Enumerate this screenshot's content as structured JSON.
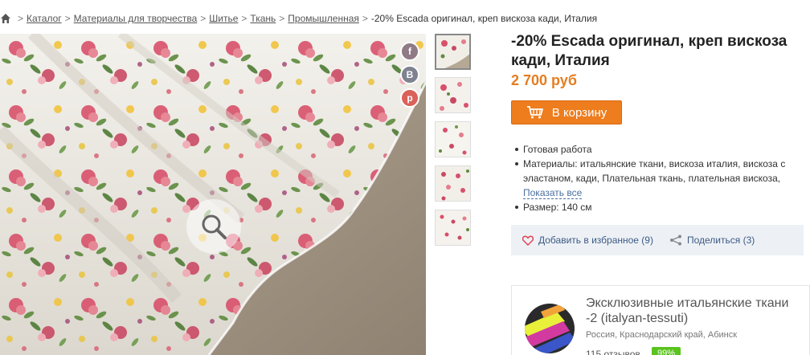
{
  "breadcrumb": {
    "items": [
      "Каталог",
      "Материалы для творчества",
      "Шитье",
      "Ткань",
      "Промышленная"
    ],
    "separator": ">",
    "current": "-20% Escada оригинал, креп вискоза кади, Италия"
  },
  "product": {
    "title": "-20% Escada оригинал, креп вискоза кади, Италия",
    "price": "2 700 руб",
    "cart_label": "В корзину"
  },
  "share": {
    "facebook": "f",
    "vk": "B",
    "pinterest": "p"
  },
  "attributes": {
    "ready": "Готовая работа",
    "materials": "Материалы: итальянские ткани, вискоза италия, вискоза с эластаном, кади, Плательная ткань, плательная вискоза,",
    "show_all": "Показать все",
    "size": "Размер: 140 см"
  },
  "actions": {
    "favorite": "Добавить в избранное (9)",
    "share": "Поделиться (3)"
  },
  "seller": {
    "name": "Эксклюзивные итальянские ткани -2 (italyan-tessuti)",
    "location": "Россия, Краснодарский край, Абинск",
    "reviews": "115 отзывов",
    "rating": "99%"
  },
  "colors": {
    "accent": "#ee7d1e",
    "price": "#e57d20",
    "link": "#3d5a84",
    "badge": "#5ac31e"
  },
  "icons": [
    "home-icon",
    "facebook-icon",
    "vk-icon",
    "pinterest-icon",
    "zoom-icon",
    "cart-icon",
    "heart-icon",
    "share-icon"
  ]
}
